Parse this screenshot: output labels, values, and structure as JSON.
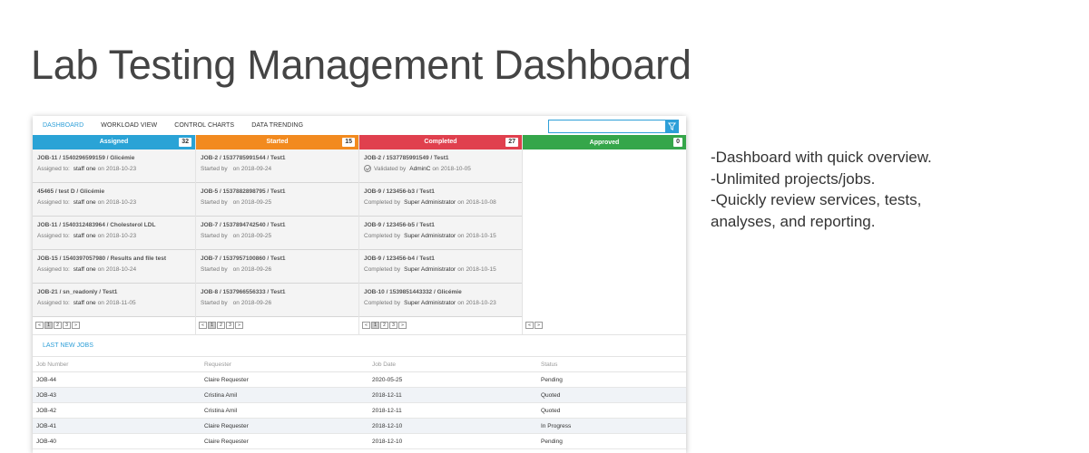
{
  "page_title": "Lab Testing Management Dashboard",
  "nav": {
    "tabs": [
      {
        "label": "DASHBOARD",
        "active": true
      },
      {
        "label": "WORKLOAD VIEW",
        "active": false
      },
      {
        "label": "CONTROL CHARTS",
        "active": false
      },
      {
        "label": "DATA TRENDING",
        "active": false
      }
    ],
    "search": {
      "value": "",
      "placeholder": ""
    }
  },
  "columns": [
    {
      "title": "Assigned",
      "count": "32",
      "color": "#2aa3d6",
      "cards": [
        {
          "title": "JOB-11 / 1540296599159 / Glicémie",
          "prefix": "Assigned to:",
          "who": "staff one",
          "on": "on",
          "date": "2018-10-23"
        },
        {
          "title": "45465 / test D / Glicémie",
          "prefix": "Assigned to:",
          "who": "staff one",
          "on": "on",
          "date": "2018-10-23"
        },
        {
          "title": "JOB-11 / 1540312483964 / Cholesterol LDL",
          "prefix": "Assigned to:",
          "who": "staff one",
          "on": "on",
          "date": "2018-10-23"
        },
        {
          "title": "JOB-15 / 1540397057980 / Results and file test",
          "prefix": "Assigned to:",
          "who": "staff one",
          "on": "on",
          "date": "2018-10-24"
        },
        {
          "title": "JOB-21 / sn_readonly / Test1",
          "prefix": "Assigned to:",
          "who": "staff one",
          "on": "on",
          "date": "2018-11-05"
        }
      ],
      "pager": [
        "«",
        "1",
        "2",
        "3",
        "»"
      ]
    },
    {
      "title": "Started",
      "count": "15",
      "color": "#f28a1f",
      "cards": [
        {
          "title": "JOB-2 / 1537785991544 / Test1",
          "prefix": "Started by",
          "who": "",
          "on": "on",
          "date": "2018-09-24"
        },
        {
          "title": "JOB-5 / 1537882898795 / Test1",
          "prefix": "Started by",
          "who": "",
          "on": "on",
          "date": "2018-09-25"
        },
        {
          "title": "JOB-7 / 1537894742540 / Test1",
          "prefix": "Started by",
          "who": "",
          "on": "on",
          "date": "2018-09-25"
        },
        {
          "title": "JOB-7 / 1537957100860 / Test1",
          "prefix": "Started by",
          "who": "",
          "on": "on",
          "date": "2018-09-26"
        },
        {
          "title": "JOB-8 / 1537966556333 / Test1",
          "prefix": "Started by",
          "who": "",
          "on": "on",
          "date": "2018-09-26"
        }
      ],
      "pager": [
        "«",
        "1",
        "2",
        "3",
        "»"
      ]
    },
    {
      "title": "Completed",
      "count": "27",
      "color": "#e0404e",
      "cards": [
        {
          "title": "JOB-2 / 1537785991549 / Test1",
          "prefix": "Validated by",
          "who": "AdminC",
          "on": "on",
          "date": "2018-10-05",
          "icon": true
        },
        {
          "title": "JOB-9 / 123456-b3 / Test1",
          "prefix": "Completed by",
          "who": "Super Administrator",
          "on": "on",
          "date": "2018-10-08"
        },
        {
          "title": "JOB-9 / 123456-b5 / Test1",
          "prefix": "Completed by",
          "who": "Super Administrator",
          "on": "on",
          "date": "2018-10-15"
        },
        {
          "title": "JOB-9 / 123456-b4 / Test1",
          "prefix": "Completed by",
          "who": "Super Administrator",
          "on": "on",
          "date": "2018-10-15"
        },
        {
          "title": "JOB-10 / 1539851443332 / Glicémie",
          "prefix": "Completed by",
          "who": "Super Administrator",
          "on": "on",
          "date": "2018-10-23"
        }
      ],
      "pager": [
        "«",
        "1",
        "2",
        "3",
        "»"
      ]
    },
    {
      "title": "Approved",
      "count": "0",
      "color": "#35a64a",
      "cards": [],
      "pager": [
        "«",
        "»"
      ]
    }
  ],
  "last_jobs": {
    "title": "LAST NEW JOBS",
    "headers": [
      "Job Number",
      "Requester",
      "Job Date",
      "Status"
    ],
    "rows": [
      [
        "JOB-44",
        "Claire Requester",
        "2020-05-25",
        "Pending"
      ],
      [
        "JOB-43",
        "Cristina Amil",
        "2018-12-11",
        "Quoted"
      ],
      [
        "JOB-42",
        "Cristina Amil",
        "2018-12-11",
        "Quoted"
      ],
      [
        "JOB-41",
        "Claire Requester",
        "2018-12-10",
        "In Progress"
      ],
      [
        "JOB-40",
        "Claire Requester",
        "2018-12-10",
        "Pending"
      ]
    ]
  },
  "features": [
    "-Dashboard with quick overview.",
    "-Unlimited projects/jobs.",
    "-Quickly review services, tests,",
    "analyses, and reporting."
  ],
  "accent_color": "#2e9fd8"
}
